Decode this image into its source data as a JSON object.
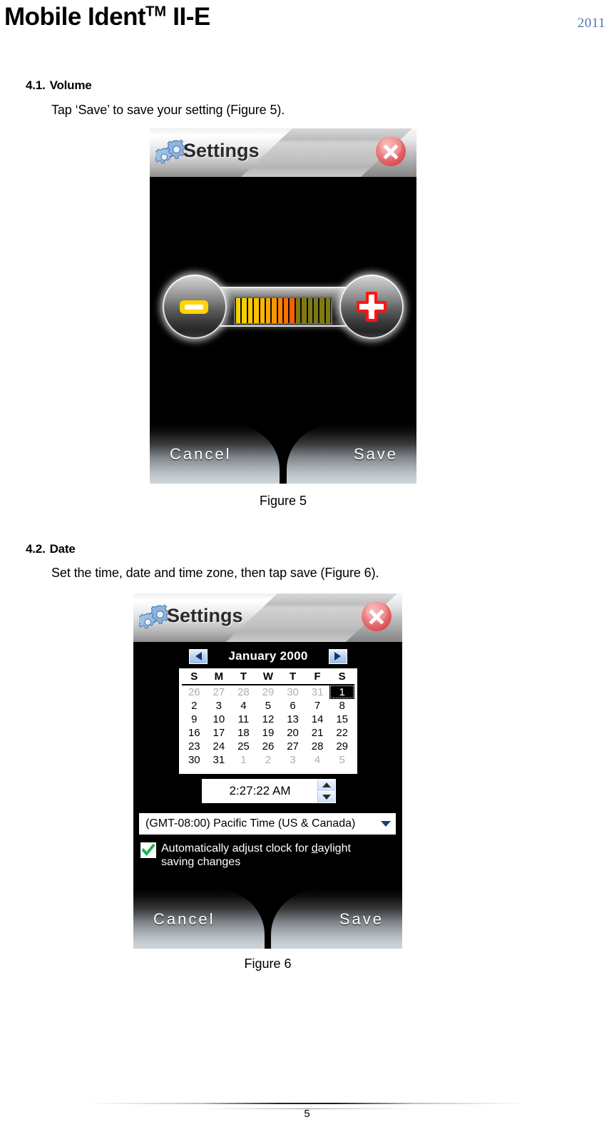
{
  "header": {
    "title_main": "Mobile Ident",
    "title_sup": "TM",
    "title_tail": " II-E",
    "year": "2011",
    "year_color": "#4a76b0"
  },
  "sections": [
    {
      "number": "4.1.",
      "title": "Volume",
      "body": "Tap ‘Save’ to save your setting (Figure 5).",
      "caption": "Figure 5"
    },
    {
      "number": "4.2.",
      "title": "Date",
      "body": "Set the time, date and time zone, then tap save (Figure 6).",
      "caption": "Figure 6"
    }
  ],
  "device_volume": {
    "titlebar": {
      "title": "Settings",
      "gear_icon": "gears-icon",
      "close_icon": "close-icon",
      "close_color": "#e8696d"
    },
    "volume_meter": {
      "total_segments": 16,
      "lit_segments": 10,
      "segment_colors": [
        "#f5d400",
        "#f7cf00",
        "#f8c800",
        "#f9c000",
        "#fab500",
        "#fba800",
        "#fb9600",
        "#fb8400",
        "#f97200",
        "#f45e06",
        "#7d7a12",
        "#7d7a12",
        "#7d7a12",
        "#7d7a12",
        "#7d7a12",
        "#7d7a12"
      ],
      "minus_icon": "minus-icon",
      "plus_icon": "plus-icon",
      "minus_color": "#ffd400",
      "plus_color": "#ff1414"
    },
    "buttons": {
      "cancel": "Cancel",
      "save": "Save"
    }
  },
  "device_date": {
    "titlebar": {
      "title": "Settings",
      "gear_icon": "gears-icon",
      "close_icon": "close-icon",
      "close_color": "#e8696d"
    },
    "calendar": {
      "prev_icon": "arrow-left-icon",
      "next_icon": "arrow-right-icon",
      "month_label": "January 2000",
      "weekday_headers": [
        "S",
        "M",
        "T",
        "W",
        "T",
        "F",
        "S"
      ],
      "weeks": [
        [
          {
            "d": "26",
            "state": "dim"
          },
          {
            "d": "27",
            "state": "dim"
          },
          {
            "d": "28",
            "state": "dim"
          },
          {
            "d": "29",
            "state": "dim"
          },
          {
            "d": "30",
            "state": "dim"
          },
          {
            "d": "31",
            "state": "dim"
          },
          {
            "d": "1",
            "state": "sel"
          }
        ],
        [
          {
            "d": "2",
            "state": ""
          },
          {
            "d": "3",
            "state": ""
          },
          {
            "d": "4",
            "state": ""
          },
          {
            "d": "5",
            "state": ""
          },
          {
            "d": "6",
            "state": ""
          },
          {
            "d": "7",
            "state": ""
          },
          {
            "d": "8",
            "state": ""
          }
        ],
        [
          {
            "d": "9",
            "state": ""
          },
          {
            "d": "10",
            "state": ""
          },
          {
            "d": "11",
            "state": ""
          },
          {
            "d": "12",
            "state": ""
          },
          {
            "d": "13",
            "state": ""
          },
          {
            "d": "14",
            "state": ""
          },
          {
            "d": "15",
            "state": ""
          }
        ],
        [
          {
            "d": "16",
            "state": ""
          },
          {
            "d": "17",
            "state": ""
          },
          {
            "d": "18",
            "state": ""
          },
          {
            "d": "19",
            "state": ""
          },
          {
            "d": "20",
            "state": ""
          },
          {
            "d": "21",
            "state": ""
          },
          {
            "d": "22",
            "state": ""
          }
        ],
        [
          {
            "d": "23",
            "state": ""
          },
          {
            "d": "24",
            "state": ""
          },
          {
            "d": "25",
            "state": ""
          },
          {
            "d": "26",
            "state": ""
          },
          {
            "d": "27",
            "state": ""
          },
          {
            "d": "28",
            "state": ""
          },
          {
            "d": "29",
            "state": ""
          }
        ],
        [
          {
            "d": "30",
            "state": ""
          },
          {
            "d": "31",
            "state": ""
          },
          {
            "d": "1",
            "state": "dim"
          },
          {
            "d": "2",
            "state": "dim"
          },
          {
            "d": "3",
            "state": "dim"
          },
          {
            "d": "4",
            "state": "dim"
          },
          {
            "d": "5",
            "state": "dim"
          }
        ]
      ]
    },
    "time": {
      "value": "2:27:22 AM",
      "spin_up_icon": "spinner-up-icon",
      "spin_down_icon": "spinner-down-icon"
    },
    "timezone": {
      "value": "(GMT-08:00) Pacific Time (US & Canada)",
      "chevron_icon": "chevron-down-icon"
    },
    "daylight": {
      "checked": true,
      "check_icon": "checkmark-icon",
      "check_color": "#22b14c",
      "label_part1": "Automatically adjust clock for ",
      "label_accel": "d",
      "label_part2": "aylight saving changes"
    },
    "buttons": {
      "cancel": "Cancel",
      "save": "Save"
    }
  },
  "footer": {
    "page_number": "5"
  }
}
